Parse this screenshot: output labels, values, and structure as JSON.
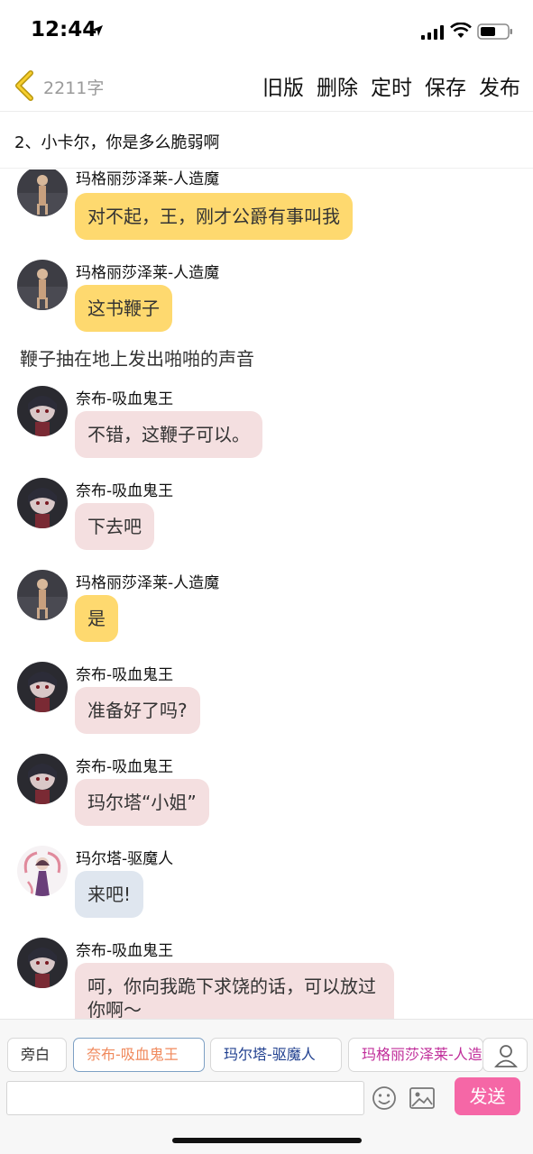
{
  "status": {
    "time": "12:44"
  },
  "header": {
    "word_count": "2211字",
    "actions": [
      "旧版",
      "删除",
      "定时",
      "保存",
      "发布"
    ]
  },
  "chapter": {
    "title": "2、小卡尔，你是多么脆弱啊"
  },
  "messages": [
    {
      "type": "msg",
      "sender": "玛格丽莎泽莱-人造魔",
      "text": "对不起，王，刚才公爵有事叫我",
      "color": "#fed96f",
      "avatar": "margo"
    },
    {
      "type": "msg",
      "sender": "玛格丽莎泽莱-人造魔",
      "text": "这书鞭子",
      "color": "#fed96f",
      "avatar": "margo"
    },
    {
      "type": "narration",
      "text": "鞭子抽在地上发出啪啪的声音"
    },
    {
      "type": "msg",
      "sender": "奈布-吸血鬼王",
      "text": "不错，这鞭子可以。",
      "color": "#f4dfe0",
      "avatar": "nabu"
    },
    {
      "type": "msg",
      "sender": "奈布-吸血鬼王",
      "text": "下去吧",
      "color": "#f4dfe0",
      "avatar": "nabu"
    },
    {
      "type": "msg",
      "sender": "玛格丽莎泽莱-人造魔",
      "text": "是",
      "color": "#fed96f",
      "avatar": "margo"
    },
    {
      "type": "msg",
      "sender": "奈布-吸血鬼王",
      "text": "准备好了吗?",
      "color": "#f4dfe0",
      "avatar": "nabu"
    },
    {
      "type": "msg",
      "sender": "奈布-吸血鬼王",
      "text": "玛尔塔“小姐”",
      "color": "#f4dfe0",
      "avatar": "nabu"
    },
    {
      "type": "msg",
      "sender": "玛尔塔-驱魔人",
      "text": "来吧!",
      "color": "#dfe6ef",
      "avatar": "marta"
    },
    {
      "type": "msg",
      "sender": "奈布-吸血鬼王",
      "text": "呵，你向我跪下求饶的话，可以放过你啊～",
      "color": "#f4dfe0",
      "avatar": "nabu"
    }
  ],
  "toolbar": {
    "roles": [
      "旁白",
      "奈布-吸血鬼王",
      "玛尔塔-驱魔人",
      "玛格丽莎泽莱-人造魔"
    ],
    "send_label": "发送",
    "input_value": ""
  },
  "colors": {
    "accent_send": "#f567a6",
    "bubble_yellow": "#fed96f",
    "bubble_pink": "#f4dfe0",
    "bubble_blue": "#dfe6ef"
  }
}
